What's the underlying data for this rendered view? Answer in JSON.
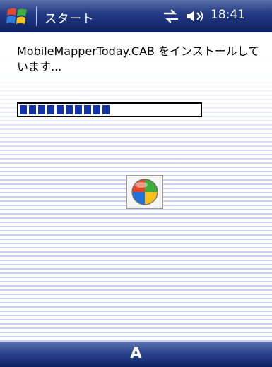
{
  "titlebar": {
    "start_label": "スタート",
    "time": "18:41",
    "icons": [
      "windows-flag-icon",
      "connectivity-icon",
      "volume-icon"
    ]
  },
  "install": {
    "message": "MobileMapperToday.CAB をインストールして\nいます...",
    "progress": 0.5
  },
  "center_icon": "windows-logo-icon",
  "bottombar": {
    "input_indicator": "A"
  }
}
